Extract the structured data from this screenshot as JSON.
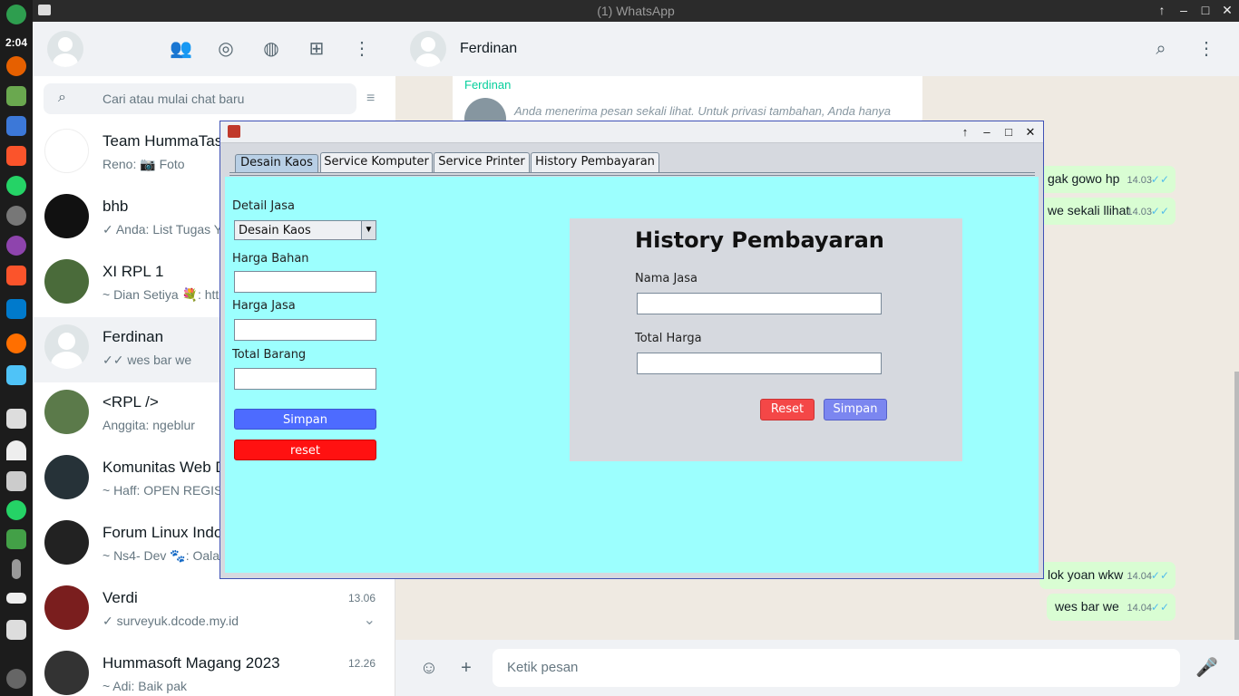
{
  "system": {
    "clock": "2:04"
  },
  "window": {
    "title": "(1) WhatsApp"
  },
  "sidebar": {
    "search_placeholder": "Cari atau mulai chat baru",
    "chats": [
      {
        "name": "Team HummaTas",
        "message": "Reno: 📷 Foto",
        "time": ""
      },
      {
        "name": "bhb",
        "message": "✓ Anda: List Tugas Y",
        "time": ""
      },
      {
        "name": "XI RPL 1",
        "message": "~ Dian Setiya 💐: htt",
        "time": ""
      },
      {
        "name": "Ferdinan",
        "message": "✓✓ wes bar we",
        "time": ""
      },
      {
        "name": "<RPL />",
        "message": "Anggita: ngeblur",
        "time": ""
      },
      {
        "name": "Komunitas Web D",
        "message": "~ Haff: OPEN REGIS",
        "time": ""
      },
      {
        "name": "Forum Linux Indo",
        "message": "~ Ns4- Dev 🐾: Oala",
        "time": ""
      },
      {
        "name": "Verdi",
        "message": "✓ surveyuk.dcode.my.id",
        "time": "13.06"
      },
      {
        "name": "Hummasoft Magang 2023",
        "message": "~ Adi: Baik pak",
        "time": "12.26"
      }
    ]
  },
  "conversation": {
    "contact_name": "Ferdinan",
    "quoted_name": "Ferdinan",
    "quoted_text": "Anda menerima pesan sekali lihat. Untuk privasi tambahan, Anda hanya",
    "messages": [
      {
        "text": "gak gowo hp",
        "time": "14.03",
        "tick": "✓✓"
      },
      {
        "text": "we sekali llihat",
        "time": "14.03",
        "tick": "✓✓"
      },
      {
        "text": "lok yoan wkw",
        "time": "14.04",
        "tick": "✓✓"
      },
      {
        "text": "wes bar we",
        "time": "14.04",
        "tick": "✓✓"
      }
    ],
    "composer_placeholder": "Ketik pesan"
  },
  "java_app": {
    "tabs": [
      "Desain Kaos",
      "Service Komputer",
      "Service Printer",
      "History Pembayaran"
    ],
    "selected_tab": "Desain Kaos",
    "form": {
      "detail_label": "Detail Jasa",
      "detail_value": "Desain Kaos",
      "harga_bahan_label": "Harga Bahan",
      "harga_jasa_label": "Harga Jasa",
      "total_barang_label": "Total Barang",
      "simpan_label": "Simpan",
      "reset_label": "reset"
    },
    "history_panel": {
      "title": "History Pembayaran",
      "nama_jasa_label": "Nama Jasa",
      "total_harga_label": "Total Harga",
      "reset_label": "Reset",
      "simpan_label": "Simpan"
    },
    "colors": {
      "content_bg": "#9cfffe",
      "simpan_blue": "#4d6bff",
      "reset_red": "#ff1111"
    }
  }
}
